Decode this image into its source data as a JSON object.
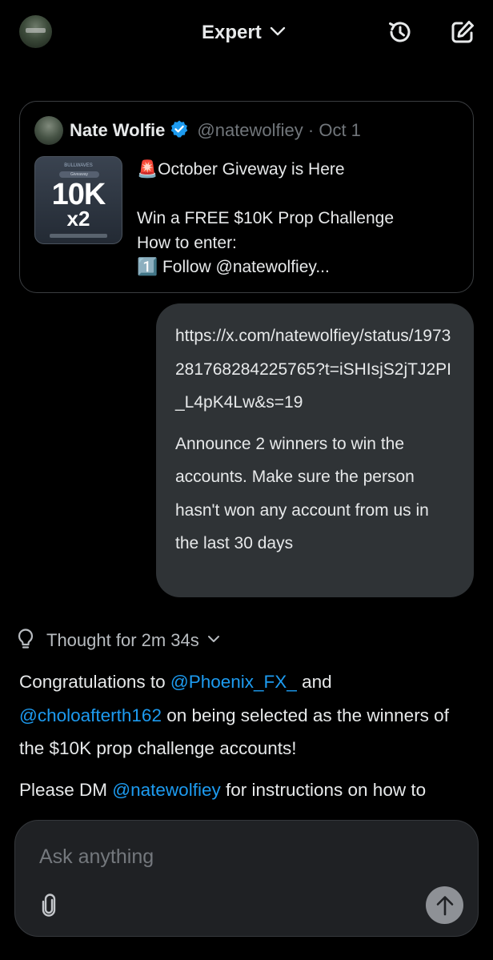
{
  "header": {
    "model_label": "Expert",
    "icons": [
      "avatar",
      "chevron-down-icon",
      "history-icon",
      "new-chat-icon"
    ]
  },
  "quote": {
    "author_name": "Nate Wolfie",
    "handle_date": "@natewolfiey · Oct 1",
    "thumb": {
      "top_text": "BULLWAVES",
      "pill_text": "Giveaway",
      "big_text": "10K",
      "sub_text": "x2"
    },
    "text_line1": "🚨October Giveway is Here",
    "text_line2": "Win a FREE $10K Prop Challenge",
    "text_line3": "How to enter:",
    "text_line4": "1️⃣ Follow @natewolfiey..."
  },
  "user_message": {
    "link": "https://x.com/natewolfiey/status/1973281768284225765?t=iSHIsjS2jTJ2PI_L4pK4Lw&s=19",
    "text": "Announce 2 winners to win the accounts. Make sure the person hasn't won any account from us in the last 30 days"
  },
  "thought": {
    "label": "Thought for 2m 34s"
  },
  "response": {
    "p1_prefix": "Congratulations to ",
    "mention1": "@Phoenix_FX_",
    "p1_and": " and",
    "mention2": "@choloafterth162",
    "p1_suffix": " on being selected as the winners of the $10K prop challenge accounts!",
    "p2_prefix": "Please DM ",
    "mention3": "@natewolfiey",
    "p2_suffix": " for instructions on how to"
  },
  "composer": {
    "placeholder": "Ask anything"
  },
  "colors": {
    "background": "#000000",
    "bubble": "#2f3336",
    "mention": "#1d9bf0",
    "verified": "#1d9bf0",
    "send_button": "#8e9196"
  }
}
